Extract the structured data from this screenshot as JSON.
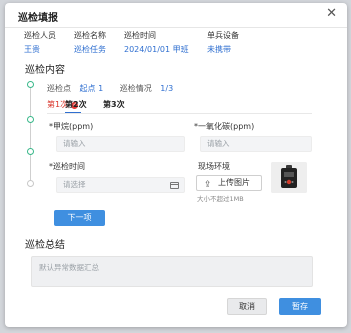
{
  "dialog": {
    "title": "巡检填报"
  },
  "info": [
    {
      "label": "巡检人员",
      "value": "王贵"
    },
    {
      "label": "巡检名称",
      "value": "巡检任务"
    },
    {
      "label": "巡检时间",
      "value": "2024/01/01 甲班"
    },
    {
      "label": "单兵设备",
      "value": "未携带"
    }
  ],
  "content": {
    "title": "巡检内容",
    "point_label": "巡检点",
    "point_value": "起点 1",
    "status_label": "巡检情况",
    "status_value": "1/3",
    "tabs": [
      "第1次",
      "第2次",
      "第3次"
    ],
    "fields": {
      "methane_label": "*甲烷(ppm)",
      "methane_placeholder": "请输入",
      "co_label": "*一氧化碳(ppm)",
      "co_placeholder": "请输入",
      "time_label": "*巡检时间",
      "time_placeholder": "请选择",
      "env_label": "现场环境",
      "upload_label": "上传图片",
      "upload_hint": "大小不超过1MB"
    },
    "next_label": "下一项"
  },
  "summary": {
    "title": "巡检总结",
    "placeholder": "默认异常数据汇总"
  },
  "footer": {
    "cancel_label": "取消",
    "save_label": "暂存"
  },
  "colors": {
    "accent": "#3f8fe0",
    "link": "#2f6fd0",
    "alert": "#d9362b",
    "timeline": "#39b88a"
  }
}
